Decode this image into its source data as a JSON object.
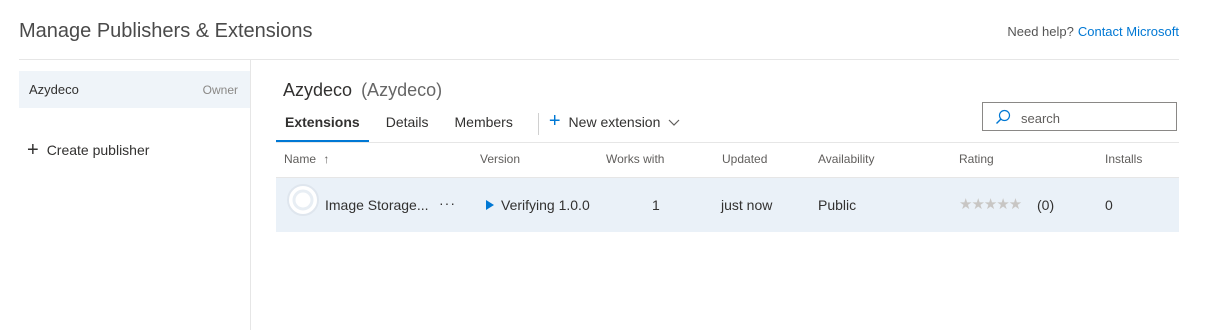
{
  "header": {
    "title": "Manage Publishers & Extensions",
    "help_text": "Need help?",
    "contact_link": "Contact Microsoft"
  },
  "sidebar": {
    "publishers": [
      {
        "name": "Azydeco",
        "role": "Owner",
        "selected": true
      }
    ],
    "create_label": "Create publisher"
  },
  "main": {
    "publisher_name": "Azydeco",
    "publisher_id": "(Azydeco)",
    "tabs": [
      {
        "label": "Extensions",
        "active": true
      },
      {
        "label": "Details",
        "active": false
      },
      {
        "label": "Members",
        "active": false
      }
    ],
    "new_extension_label": "New extension",
    "search": {
      "placeholder": "search",
      "value": ""
    },
    "columns": {
      "name": "Name",
      "sort_indicator": "↑",
      "version": "Version",
      "works_with": "Works with",
      "updated": "Updated",
      "availability": "Availability",
      "rating": "Rating",
      "installs": "Installs"
    },
    "rows": [
      {
        "name": "Image Storage...",
        "more": "···",
        "version_status": "Verifying 1.0.0",
        "works_with": "1",
        "updated": "just now",
        "availability": "Public",
        "stars": "★★★★★",
        "rating_count": "(0)",
        "installs": "0"
      }
    ]
  },
  "colors": {
    "accent": "#0078d4",
    "selected_bg": "#eff4f9",
    "row_bg": "#eaf1f8"
  }
}
